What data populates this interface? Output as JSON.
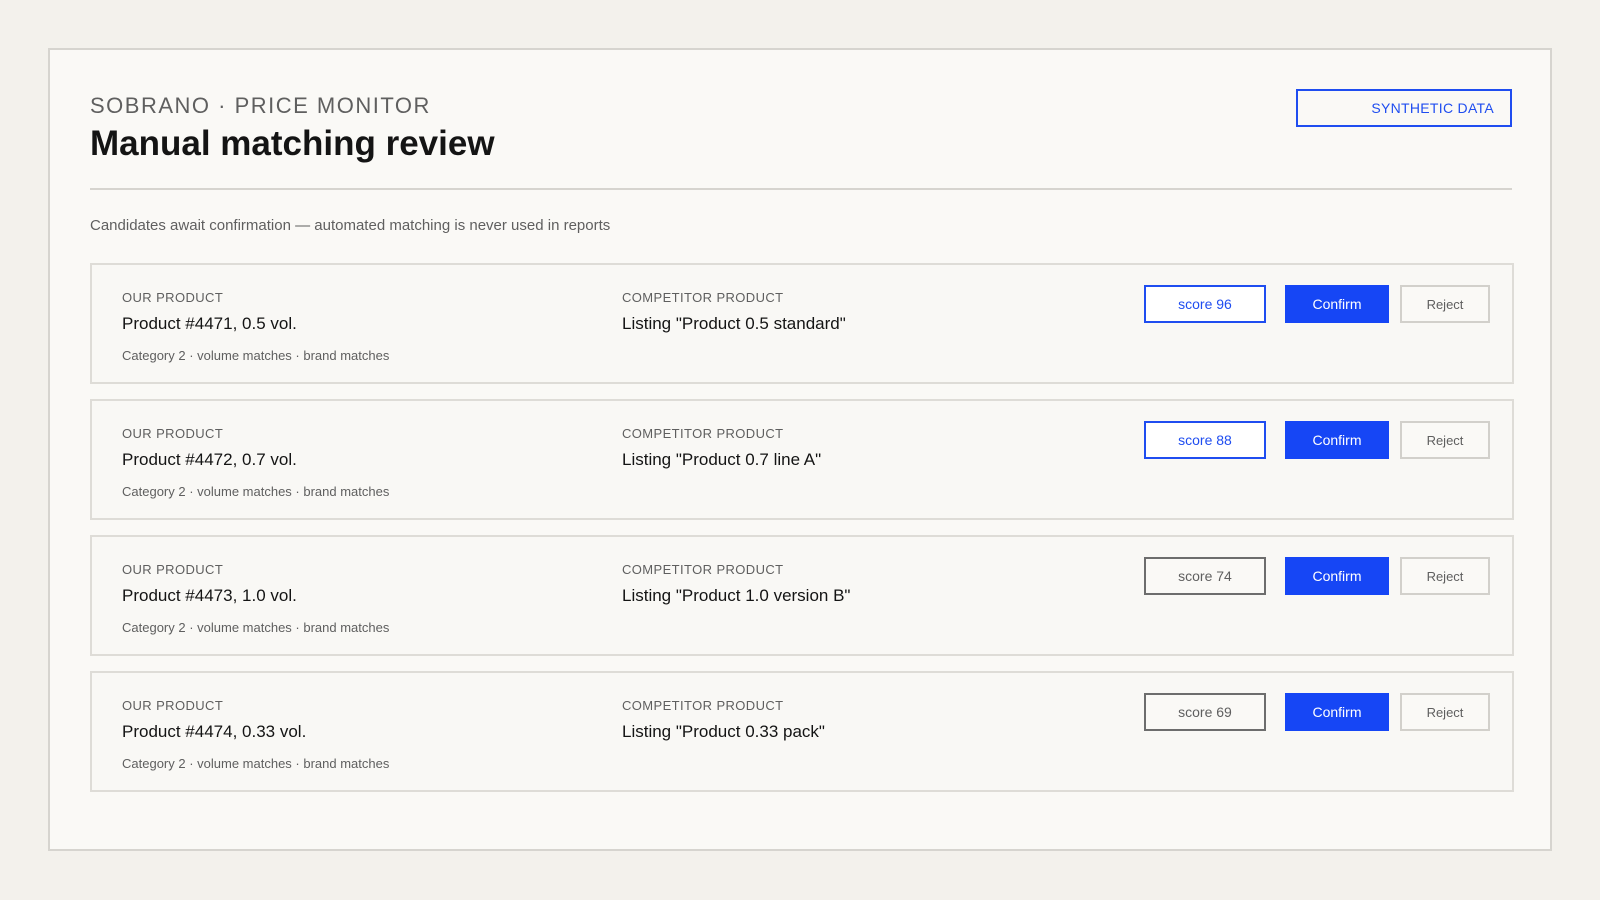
{
  "header": {
    "eyebrow": "SOBRANO · PRICE MONITOR",
    "title": "Manual matching review",
    "badge": "SYNTHETIC DATA",
    "subtitle": "Candidates await confirmation — automated matching is never used in reports"
  },
  "labels": {
    "our_product": "OUR PRODUCT",
    "competitor_product": "COMPETITOR PRODUCT",
    "confirm": "Confirm",
    "reject": "Reject"
  },
  "colors": {
    "accent": "#1646f5",
    "background": "#f3f1ec",
    "panel": "#faf9f6"
  },
  "rows": [
    {
      "our_product": "Product #4471, 0.5 vol.",
      "meta": "Category 2 · volume matches · brand matches",
      "competitor_product": "Listing \"Product 0.5 standard\"",
      "score": "score 96",
      "score_level": "high"
    },
    {
      "our_product": "Product #4472, 0.7 vol.",
      "meta": "Category 2 · volume matches · brand matches",
      "competitor_product": "Listing \"Product 0.7 line A\"",
      "score": "score 88",
      "score_level": "high"
    },
    {
      "our_product": "Product #4473, 1.0 vol.",
      "meta": "Category 2 · volume matches · brand matches",
      "competitor_product": "Listing \"Product 1.0 version B\"",
      "score": "score 74",
      "score_level": "low"
    },
    {
      "our_product": "Product #4474, 0.33 vol.",
      "meta": "Category 2 · volume matches · brand matches",
      "competitor_product": "Listing \"Product 0.33 pack\"",
      "score": "score 69",
      "score_level": "low"
    }
  ]
}
